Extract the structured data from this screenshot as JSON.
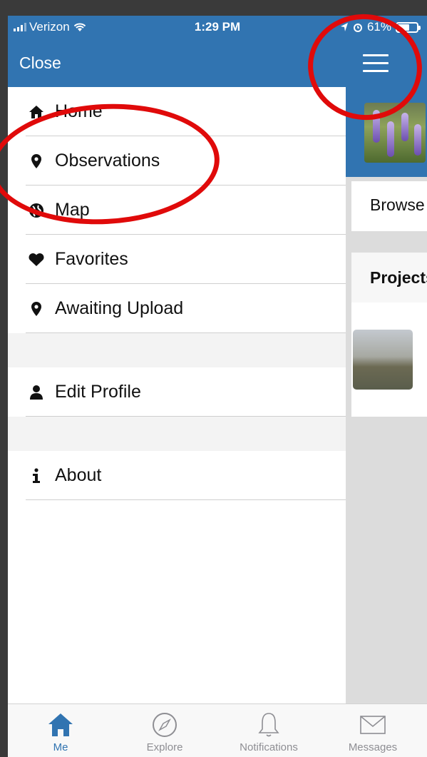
{
  "status_bar": {
    "carrier": "Verizon",
    "time": "1:29 PM",
    "battery": "61%",
    "battery_level": 0.61
  },
  "drawer": {
    "close_label": "Close",
    "items": [
      {
        "label": "Home",
        "icon": "home-icon"
      },
      {
        "label": "Observations",
        "icon": "map-pin-icon"
      },
      {
        "label": "Map",
        "icon": "globe-icon"
      },
      {
        "label": "Favorites",
        "icon": "heart-icon"
      },
      {
        "label": "Awaiting Upload",
        "icon": "map-pin-icon"
      }
    ],
    "profile": {
      "label": "Edit Profile",
      "icon": "user-icon"
    },
    "about": {
      "label": "About",
      "icon": "info-icon"
    }
  },
  "main": {
    "browse_label": "Browse",
    "projects_label": "Projects"
  },
  "tab_bar": {
    "tabs": [
      {
        "label": "Me",
        "icon": "home-icon",
        "active": true
      },
      {
        "label": "Explore",
        "icon": "compass-icon",
        "active": false
      },
      {
        "label": "Notifications",
        "icon": "bell-icon",
        "active": false
      },
      {
        "label": "Messages",
        "icon": "envelope-icon",
        "active": false
      }
    ]
  },
  "colors": {
    "brand": "#3174b1",
    "annotation": "#e00a0a"
  }
}
